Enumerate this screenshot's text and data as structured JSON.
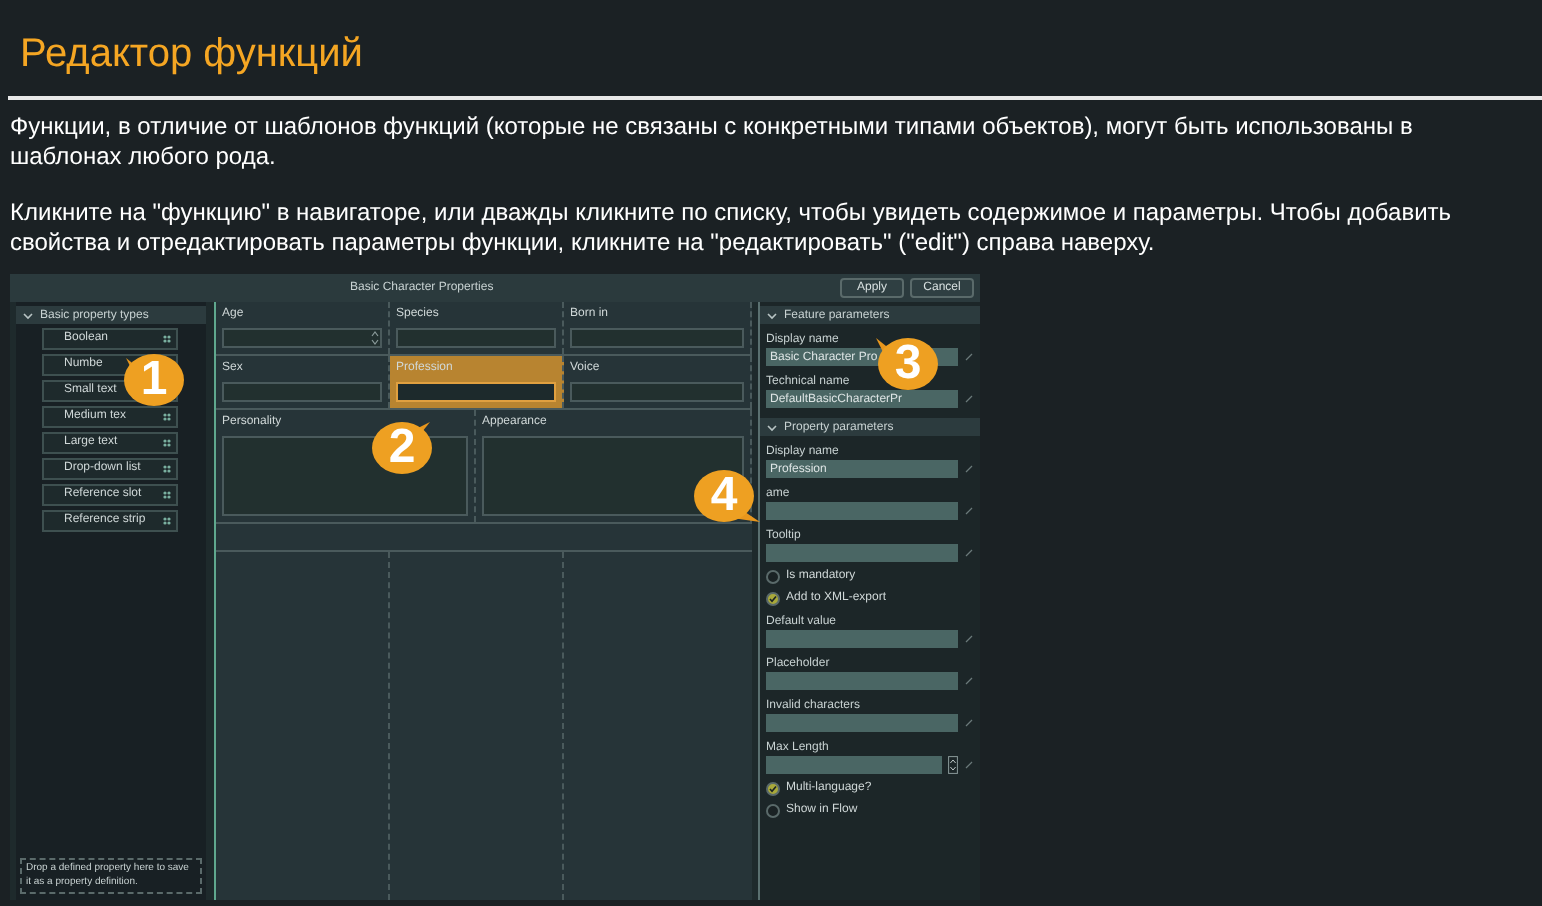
{
  "page": {
    "title": "Редактор функций",
    "paragraphs": [
      "Функции, в отличие от шаблонов функций (которые не связаны с конкретными типами объектов), могут быть использованы в шаблонах любого рода.",
      "Кликните на \"функцию\" в навигаторе, или дважды кликните по списку, чтобы увидеть содержимое и параметры. Чтобы добавить свойства и отредактировать параметры функции, кликните на \"редактировать\" (\"edit\") справа наверху."
    ]
  },
  "app": {
    "title": "Basic Character Properties",
    "buttons": [
      "Apply",
      "Cancel"
    ],
    "palette": {
      "header": "Basic property types",
      "expanded": true,
      "items": [
        "Boolean",
        "Numbe",
        "Small text",
        "Medium tex",
        "Large text",
        "Drop-down list",
        "Reference slot",
        "Reference strip"
      ],
      "drop_hint": "Drop a defined property here to save it as a property definition."
    },
    "form": {
      "rows": [
        [
          {
            "label": "Age",
            "kind": "number",
            "selected": false
          },
          {
            "label": "Species",
            "kind": "text",
            "selected": false
          },
          {
            "label": "Born in",
            "kind": "text",
            "selected": false
          }
        ],
        [
          {
            "label": "Sex",
            "kind": "text",
            "selected": false
          },
          {
            "label": "Profession",
            "kind": "text",
            "selected": true
          },
          {
            "label": "Voice",
            "kind": "text",
            "selected": false
          }
        ],
        [
          {
            "label": "Personality",
            "kind": "area",
            "selected": false
          },
          {
            "label": "Appearance",
            "kind": "area",
            "selected": false
          }
        ]
      ]
    },
    "feature_parameters": {
      "header": "Feature parameters",
      "expanded": true,
      "fields": [
        {
          "label": "Display name",
          "value": "Basic Character Pro"
        },
        {
          "label": "Technical name",
          "value": "DefaultBasicCharacterPr"
        }
      ]
    },
    "property_parameters": {
      "header": "Property parameters",
      "expanded": true,
      "items": [
        {
          "kind": "field",
          "label": "Display name",
          "value": "Profession"
        },
        {
          "kind": "field",
          "label": "ame"
        },
        {
          "kind": "field",
          "label": "Tooltip"
        },
        {
          "kind": "checkbox",
          "label": "Is mandatory",
          "checked": false
        },
        {
          "kind": "checkbox",
          "label": "Add to XML-export",
          "checked": true
        },
        {
          "kind": "field",
          "label": "Default value"
        },
        {
          "kind": "field",
          "label": "Placeholder"
        },
        {
          "kind": "field",
          "label": "Invalid characters"
        },
        {
          "kind": "number",
          "label": "Max Length"
        },
        {
          "kind": "checkbox",
          "label": "Multi-language?",
          "checked": true
        },
        {
          "kind": "checkbox",
          "label": "Show in Flow",
          "checked": false
        }
      ]
    },
    "callouts": [
      "1",
      "2",
      "3",
      "4"
    ]
  }
}
